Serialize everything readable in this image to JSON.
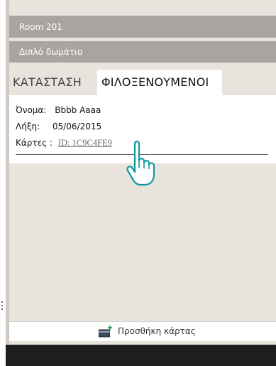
{
  "room": {
    "title": "Room 201",
    "type": "Διπλό δωμάτιο"
  },
  "tabs": [
    {
      "label": "ΚΑΤΑΣΤΑΣΗ",
      "active": false
    },
    {
      "label": "ΦΙΛΟΞΕΝΟΥΜΕΝΟΙ",
      "active": true
    }
  ],
  "guest": {
    "name_label": "Όνομα:",
    "name_value": "Bbbb Aaaa",
    "expiry_label": "Λήξη:",
    "expiry_value": "05/06/2015",
    "cards_label": "Κάρτες :",
    "card_id": "ID: 1C9C4FE9"
  },
  "add_card": {
    "label": "Προσθήκη κάρτας",
    "icon": "add-card-icon"
  },
  "colors": {
    "header_bg": "#a8a4a2",
    "panel_bg": "#e8e3dd",
    "frame_bg": "#1e1e1e",
    "cursor_stroke": "#0f9aa0"
  }
}
